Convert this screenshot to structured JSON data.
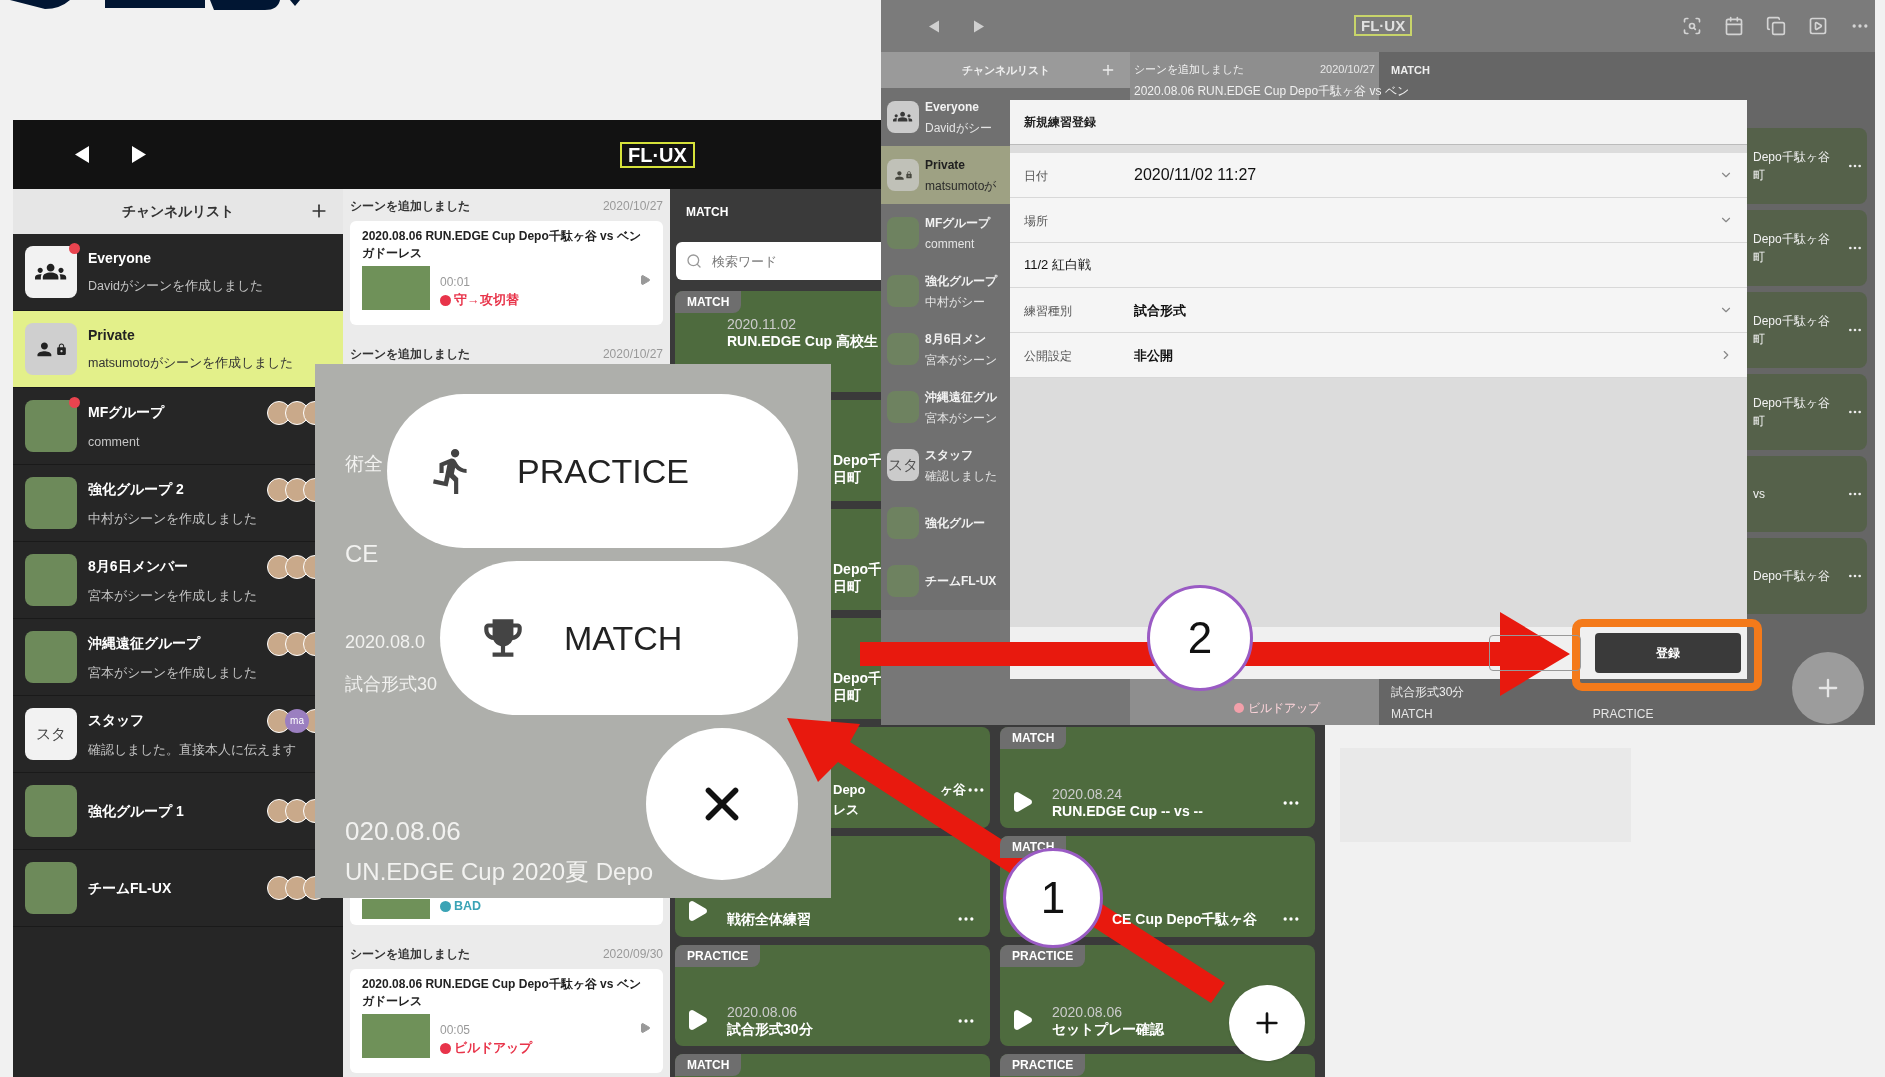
{
  "left_app": {
    "logo": "FL·UX",
    "channel_list": {
      "title": "チャンネルリスト",
      "items": [
        {
          "kind": "everyone",
          "name": "Everyone",
          "subtitle": "Davidがシーンを作成しました",
          "selected": false,
          "unread": true
        },
        {
          "kind": "private",
          "name": "Private",
          "subtitle": "matsumotoがシーンを作成しました",
          "selected": true,
          "unread": false
        },
        {
          "kind": "photo",
          "name": "MFグループ",
          "subtitle": "comment",
          "selected": false,
          "unread": true,
          "avatars": [
            {
              "kind": "photo"
            },
            {
              "kind": "photo"
            },
            {
              "kind": "photo"
            }
          ]
        },
        {
          "kind": "photo",
          "name": "強化グループ 2",
          "subtitle": "中村がシーンを作成しました",
          "selected": false,
          "unread": false,
          "avatars": [
            {
              "kind": "photo"
            },
            {
              "kind": "photo"
            },
            {
              "kind": "photo"
            }
          ]
        },
        {
          "kind": "photo",
          "name": "8月6日メンバー",
          "subtitle": "宮本がシーンを作成しました",
          "selected": false,
          "unread": false,
          "avatars": [
            {
              "kind": "photo"
            },
            {
              "kind": "photo"
            },
            {
              "kind": "photo"
            }
          ]
        },
        {
          "kind": "photo",
          "name": "沖縄遠征グループ",
          "subtitle": "宮本がシーンを作成しました",
          "selected": false,
          "unread": false,
          "avatars": [
            {
              "kind": "photo"
            },
            {
              "kind": "photo"
            },
            {
              "kind": "photo"
            }
          ]
        },
        {
          "kind": "initials",
          "initials": "スタ",
          "name": "スタッフ",
          "subtitle": "確認しました。直接本人に伝えます",
          "selected": false,
          "unread": false,
          "avatars": [
            {
              "kind": "photo"
            },
            {
              "kind": "initials",
              "text": "ma"
            },
            {
              "kind": "photo"
            }
          ]
        },
        {
          "kind": "photo",
          "name": "強化グループ 1",
          "selected": false,
          "unread": false,
          "avatars": [
            {
              "kind": "photo"
            },
            {
              "kind": "photo"
            },
            {
              "kind": "photo"
            }
          ]
        },
        {
          "kind": "photo",
          "name": "チームFL-UX",
          "selected": false,
          "unread": false,
          "avatars": [
            {
              "kind": "photo"
            },
            {
              "kind": "photo"
            },
            {
              "kind": "photo"
            }
          ]
        }
      ]
    },
    "feed": [
      {
        "kind": "scene",
        "header": "シーンを追加しました",
        "date": "2020/10/27",
        "title": "2020.08.06 RUN.EDGE Cup Depo千駄ヶ谷 vs ベンガドーレス",
        "time": "00:01",
        "tag": "守→攻切替",
        "color": "#e8344a"
      },
      {
        "kind": "header",
        "header": "シーンを追加しました",
        "date": "2020/10/27"
      },
      {
        "kind": "tag",
        "tag": "BAD",
        "color": "#3aa3b5"
      },
      {
        "kind": "scene",
        "header": "シーンを追加しました",
        "date": "2020/09/30",
        "title": "2020.08.06 RUN.EDGE Cup Depo千駄ヶ谷 vs ベンガドーレス",
        "time": "00:05",
        "tag": "ビルドアップ",
        "color": "#e8344a"
      }
    ],
    "match": {
      "title": "MATCH",
      "search": {
        "placeholder": "検索ワード"
      },
      "left_cards": [
        {
          "kind": "top",
          "label": "MATCH",
          "date": "2020.11.02",
          "title": "RUN.EDGE Cup 高校生",
          "more": false
        },
        {
          "kind": "partial",
          "title": "Depo千",
          "title_2": "日町",
          "more": false
        },
        {
          "kind": "partial",
          "title": "Depo千",
          "title_2": "日町",
          "more": false
        },
        {
          "kind": "partial",
          "title": "Depo千",
          "title_2": "日町",
          "more": false
        },
        {
          "kind": "split",
          "title": "Depo",
          "title_side": "ヶ谷",
          "title_2": "レス",
          "more": true
        },
        {
          "kind": "full",
          "title": "戦術全体練習",
          "more": true
        },
        {
          "kind": "full",
          "label": "PRACTICE",
          "date": "2020.08.06",
          "title": "試合形式30分",
          "more": true
        },
        {
          "kind": "full",
          "label": "MATCH",
          "more": false
        }
      ],
      "right_cards": [
        {
          "kind": "full",
          "label": "MATCH",
          "date": "2020.08.24",
          "title": "RUN.EDGE Cup -- vs --",
          "more": true
        },
        {
          "kind": "offset",
          "label": "MATCH",
          "title": "CE Cup Depo千駄ヶ谷",
          "more": true
        },
        {
          "kind": "full",
          "label": "PRACTICE",
          "date": "2020.08.06",
          "title": "セットプレー確認",
          "more": false
        },
        {
          "kind": "full",
          "label": "PRACTICE",
          "more": false
        }
      ]
    }
  },
  "popup": {
    "ghost_texts": [
      "術全",
      "CE",
      "2020.08.0",
      "試合形式30",
      "020.08.06",
      "UN.EDGE Cup 2020夏 Depo"
    ],
    "buttons": [
      {
        "kind": "practice",
        "label": "PRACTICE"
      },
      {
        "kind": "match",
        "label": "MATCH"
      },
      {
        "kind": "close"
      }
    ]
  },
  "right_screen": {
    "logo": "FL·UX",
    "channel_title": "チャンネルリスト",
    "channels": [
      {
        "kind": "everyone",
        "name": "Everyone",
        "subtitle": "Davidがシー",
        "selected": false
      },
      {
        "kind": "private",
        "name": "Private",
        "subtitle": "matsumotoが",
        "selected": true
      },
      {
        "kind": "photo",
        "name": "MFグループ",
        "subtitle": "comment",
        "selected": false
      },
      {
        "kind": "photo",
        "name": "強化グループ",
        "subtitle": "中村がシー",
        "selected": false
      },
      {
        "kind": "photo",
        "name": "8月6日メン",
        "subtitle": "宮本がシーン",
        "selected": false
      },
      {
        "kind": "photo",
        "name": "沖縄遠征グル",
        "subtitle": "宮本がシーン",
        "selected": false
      },
      {
        "kind": "initials",
        "initials": "スタ",
        "name": "スタッフ",
        "subtitle": "確認しました",
        "selected": false
      },
      {
        "kind": "photo",
        "name": "強化グルー",
        "selected": false
      },
      {
        "kind": "photo",
        "name": "チームFL-UX",
        "selected": false
      }
    ],
    "feed_header": "シーンを追加しました",
    "feed_date": "2020/10/27",
    "feed_title": "2020.08.06 RUN.EDGE Cup Depo千駄ヶ谷 vs ベン",
    "feed_tag": "ビルドアップ",
    "match_title": "MATCH",
    "strip_cards": [
      {
        "title": "Depo千駄ヶ谷",
        "title_2": "町"
      },
      {
        "title": "Depo千駄ヶ谷",
        "title_2": "町"
      },
      {
        "title": "Depo千駄ヶ谷",
        "title_2": "町"
      },
      {
        "title": "Depo千駄ヶ谷",
        "title_2": "町"
      },
      {
        "title": "vs"
      },
      {
        "title": "Depo千駄ヶ谷"
      }
    ],
    "bottom_card_title": "試合形式30分",
    "bottom_labels": [
      "MATCH",
      "PRACTICE"
    ],
    "dialog": {
      "title": "新規練習登録",
      "fields": [
        {
          "kind": "select",
          "label": "日付",
          "value": "2020/11/02 11:27"
        },
        {
          "kind": "select",
          "label": "場所"
        },
        {
          "kind": "text",
          "value": "11/2 紅白戦"
        },
        {
          "kind": "select",
          "label": "練習種別",
          "value": "試合形式"
        },
        {
          "kind": "link",
          "label": "公開設定",
          "value": "非公開"
        }
      ],
      "submit": "登録"
    }
  },
  "annotations": [
    {
      "kind": "step",
      "label": "1"
    },
    {
      "kind": "step",
      "label": "2"
    }
  ]
}
